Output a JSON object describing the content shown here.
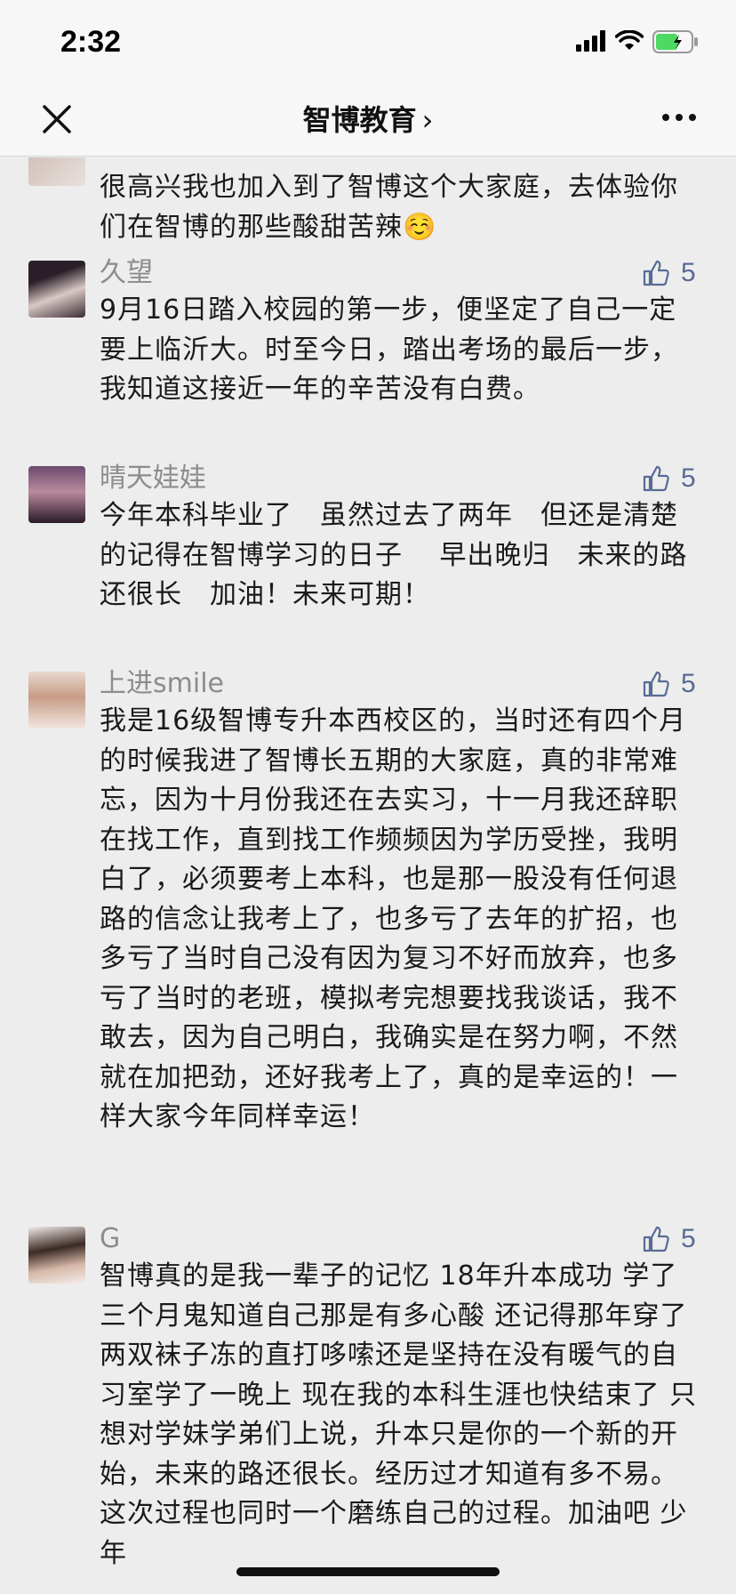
{
  "status": {
    "time": "2:32"
  },
  "nav": {
    "title": "智博教育",
    "chevron": "›"
  },
  "icons": {
    "close": "close-icon",
    "more": "more-icon",
    "like": "thumbs-up-icon",
    "signal": "signal-icon",
    "wifi": "wifi-icon",
    "battery": "battery-icon"
  },
  "colors": {
    "link": "#576b95",
    "name": "#8c8c8c",
    "background": "#ededed"
  },
  "comments": [
    {
      "name": "",
      "likes": "",
      "text": "很高兴我也加入到了智博这个大家庭，去体验你们在智博的那些酸甜苦辣☺️"
    },
    {
      "name": "久望",
      "likes": "5",
      "text": "9月16日踏入校园的第一步，便坚定了自己一定要上临沂大。时至今日，踏出考场的最后一步，我知道这接近一年的辛苦没有白费。"
    },
    {
      "name": "晴天娃娃",
      "likes": "5",
      "text": "今年本科毕业了　虽然过去了两年　但还是清楚的记得在智博学习的日子　 早出晚归　未来的路还很长　加油！未来可期！"
    },
    {
      "name": "上进smile",
      "likes": "5",
      "text": "我是16级智博专升本西校区的，当时还有四个月的时候我进了智博长五期的大家庭，真的非常难忘，因为十月份我还在去实习，十一月我还辞职在找工作，直到找工作频频因为学历受挫，我明白了，必须要考上本科，也是那一股没有任何退路的信念让我考上了，也多亏了去年的扩招，也多亏了当时自己没有因为复习不好而放弃，也多亏了当时的老班，模拟考完想要找我谈话，我不敢去，因为自己明白，我确实是在努力啊，不然就在加把劲，还好我考上了，真的是幸运的！一样大家今年同样幸运！"
    },
    {
      "name": "G",
      "likes": "5",
      "text": "智博真的是我一辈子的记忆 18年升本成功 学了三个月鬼知道自己那是有多心酸 还记得那年穿了两双袜子冻的直打哆嗦还是坚持在没有暖气的自习室学了一晚上 现在我的本科生涯也快结束了 只想对学妹学弟们上说，升本只是你的一个新的开始，未来的路还很长。经历过才知道有多不易。这次过程也同时一个磨练自己的过程。加油吧 少年"
    }
  ]
}
